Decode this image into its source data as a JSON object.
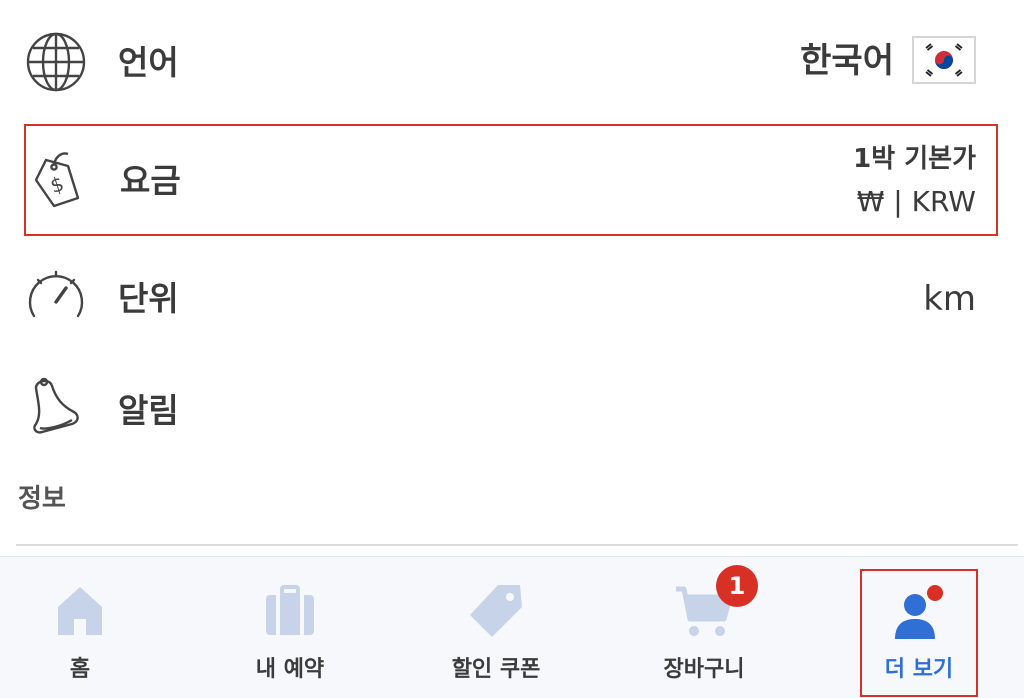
{
  "settings": {
    "language": {
      "label": "언어",
      "value": "한국어",
      "flag_icon": "korea-flag-icon"
    },
    "currency": {
      "label": "요금",
      "price_basis": "1박 기본가",
      "currency_value": "₩ | KRW"
    },
    "units": {
      "label": "단위",
      "value": "km"
    },
    "alerts": {
      "label": "알림"
    }
  },
  "section": {
    "title": "정보"
  },
  "nav": {
    "home": "홈",
    "reservations": "내 예약",
    "coupons": "할인 쿠폰",
    "cart": "장바구니",
    "cart_badge": "1",
    "more": "더 보기"
  },
  "colors": {
    "highlight_border": "#d93025",
    "active_nav": "#2f6fd6",
    "inactive_nav_icon": "#c7d3e8",
    "badge": "#d93025"
  }
}
